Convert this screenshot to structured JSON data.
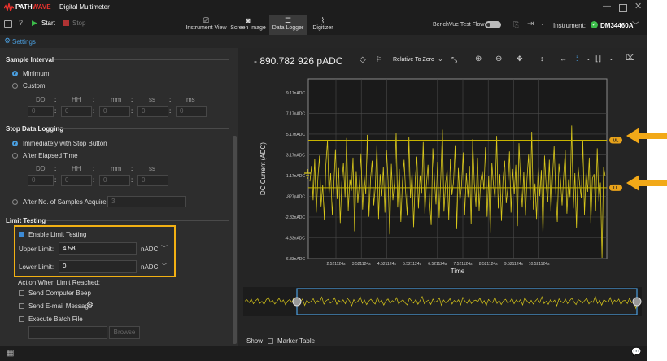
{
  "title": {
    "brand_a": "PATH",
    "brand_b": "WAVE",
    "app": "Digital Multimeter"
  },
  "toolbar": {
    "start": "Start",
    "stop": "Stop",
    "tabs": [
      "Instrument View",
      "Screen Image",
      "Data Logger",
      "Digitizer"
    ],
    "benchvue": "BenchVue Test Flow",
    "instrument_label": "Instrument:",
    "instrument": "DM34460A"
  },
  "settings_label": "Settings",
  "sample_interval": {
    "title": "Sample Interval",
    "minimum": "Minimum",
    "custom": "Custom",
    "headers": [
      "DD",
      "HH",
      "mm",
      "ss",
      "ms"
    ],
    "values": [
      "0",
      "0",
      "0",
      "0",
      "0"
    ]
  },
  "stop_logging": {
    "title": "Stop Data Logging",
    "opt1": "Immediately with Stop Button",
    "opt2": "After Elapsed Time",
    "headers": [
      "DD",
      "HH",
      "mm",
      "ss"
    ],
    "values": [
      "0",
      "0",
      "0",
      "0"
    ],
    "opt3": "After No. of Samples Acquired",
    "samples": "3"
  },
  "limits": {
    "title": "Limit Testing",
    "enable": "Enable Limit Testing",
    "upper_label": "Upper Limit:",
    "upper_value": "4.58",
    "lower_label": "Lower Limit:",
    "lower_value": "0",
    "unit": "nADC",
    "action_title": "Action When Limit Reached:",
    "beep": "Send Computer Beep",
    "email": "Send E-mail Message",
    "batch": "Execute Batch File",
    "browse": "Browse"
  },
  "readout": {
    "value": "- 890.782 926 pADC",
    "mode": "Relative To Zero"
  },
  "footer": {
    "show": "Show",
    "marker": "Marker Table"
  },
  "colors": {
    "trace": "#d9c81a",
    "limit_line": "#c8b400",
    "accent": "#3d8bd6",
    "highlight": "#f2b013",
    "arrow": "#f2a918"
  },
  "chart_data": {
    "type": "line",
    "xlabel": "Time",
    "ylabel": "DC Current (ADC)",
    "y_ticks": [
      "9.17nADC",
      "7.17nADC",
      "5.17nADC",
      "3.17nADC",
      "1.17nADC",
      "-827pADC",
      "-2.83nADC",
      "-4.83nADC",
      "-6.83nADC"
    ],
    "y_values": [
      9.17,
      7.17,
      5.17,
      3.17,
      1.17,
      -0.827,
      -2.83,
      -4.83,
      -6.83
    ],
    "x_ticks": [
      "2.521124s",
      "3.521124s",
      "4.521124s",
      "5.521124s",
      "6.521124s",
      "7.521124s",
      "8.521124s",
      "9.521124s",
      "10.521124s"
    ],
    "ylim": [
      -6.83,
      10.5
    ],
    "upper_limit": 4.58,
    "lower_limit": 0,
    "upper_marker": "UL",
    "lower_marker": "LL",
    "grid": true,
    "series": [
      {
        "values": [
          0.6,
          2.1,
          -1.2,
          2.8,
          -2.4,
          0.9,
          3.1,
          -1.8,
          0.3,
          -3.1,
          2.2,
          4.6,
          -0.7,
          1.4,
          -2.6,
          0.2,
          3.7,
          -1.1,
          1.9,
          -3.4,
          0.5,
          2.4,
          -0.9,
          4.8,
          -2.2,
          0.8,
          -0.3,
          2.9,
          -4.2,
          1.6,
          -1.5,
          0.4,
          3.3,
          -2.1,
          1.1,
          -0.6,
          5.1,
          -2.8,
          0.9,
          2.6,
          -1.7,
          0.1,
          4.2,
          -3.0,
          1.3,
          -0.8,
          2.0,
          -2.4,
          3.6,
          0.7,
          -4.5,
          2.3,
          -1.2,
          0.5,
          5.3,
          -1.9,
          1.8,
          -3.3,
          0.6,
          2.7,
          -0.4,
          -2.7,
          4.9,
          -1.0,
          1.5,
          -3.8,
          0.8,
          3.0,
          -2.0,
          1.2,
          -0.5,
          4.4,
          -2.5,
          0.3,
          2.2,
          -1.4,
          -3.6,
          3.8,
          0.9,
          -1.6,
          2.5,
          -2.9,
          1.0,
          5.6,
          -2.3,
          0.4,
          1.7,
          -3.1,
          2.8,
          -0.7,
          0.6,
          4.1,
          -4.0,
          1.9,
          -1.3,
          0.2,
          3.4,
          -2.6,
          1.4,
          -0.9,
          2.1,
          -3.5,
          4.7,
          0.5,
          -1.8,
          2.9,
          -2.2,
          0.7,
          1.6,
          -0.2,
          3.9,
          -2.8,
          1.1,
          -4.3,
          2.4,
          0.3,
          -1.1,
          5.0,
          -2.0,
          1.3,
          -3.2,
          0.8,
          2.6,
          -1.5,
          0.0,
          3.5,
          -2.4,
          1.8,
          -0.6,
          2.2,
          -3.7,
          4.3,
          0.6,
          -1.9,
          1.5,
          -2.7,
          0.9,
          3.2,
          -1.2,
          5.4,
          -2.1,
          0.4,
          -3.0,
          2.0,
          -0.8,
          1.7,
          -4.6,
          3.1,
          0.2,
          -1.4,
          2.7,
          -2.3,
          1.0,
          4.0,
          -0.5,
          -3.3,
          2.3,
          0.7,
          -1.7,
          1.2,
          3.6,
          -2.5,
          0.8,
          -0.9,
          6.0,
          -2.0,
          1.4,
          -3.9,
          2.1,
          0.3,
          -1.0,
          4.5,
          -2.6,
          1.6,
          -0.4,
          2.9,
          -3.4,
          0.9,
          1.3,
          -2.2,
          3.8,
          -1.3,
          0.5,
          -7.5,
          2.0,
          1.1
        ]
      }
    ]
  }
}
